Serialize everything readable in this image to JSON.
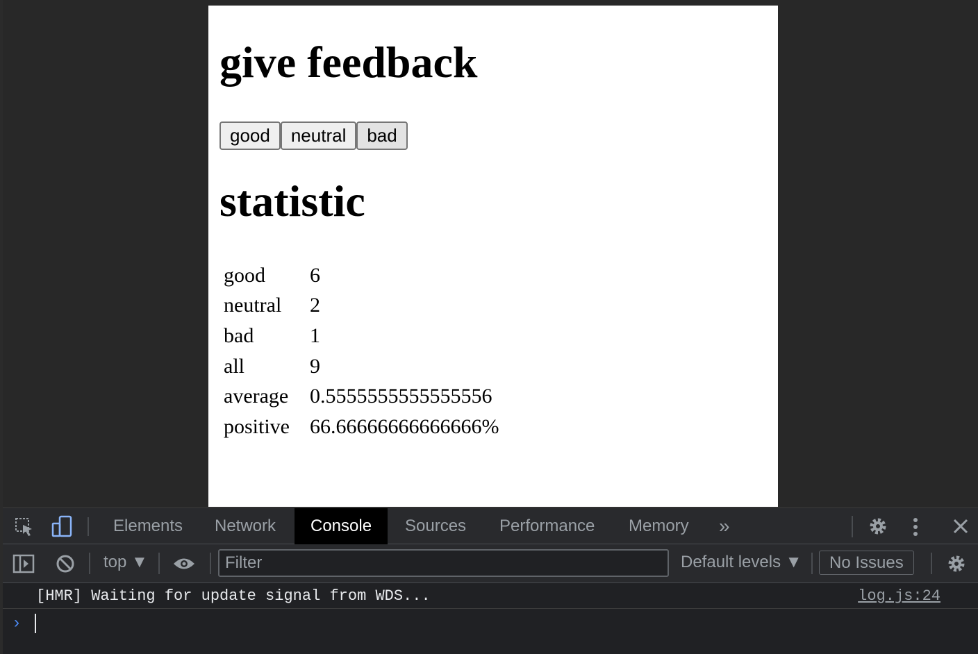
{
  "page": {
    "feedback_heading": "give feedback",
    "buttons": [
      "good",
      "neutral",
      "bad"
    ],
    "statistic_heading": "statistic",
    "stats": [
      {
        "label": "good",
        "value": "6"
      },
      {
        "label": "neutral",
        "value": "2"
      },
      {
        "label": "bad",
        "value": "1"
      },
      {
        "label": "all",
        "value": "9"
      },
      {
        "label": "average",
        "value": "0.5555555555555556"
      },
      {
        "label": "positive",
        "value": "66.66666666666666%"
      }
    ]
  },
  "devtools": {
    "tabs": [
      "Elements",
      "Network",
      "Console",
      "Sources",
      "Performance",
      "Memory"
    ],
    "active_tab": "Console",
    "more_tabs": "»",
    "context": "top ▼",
    "filter_placeholder": "Filter",
    "levels": "Default levels ▼",
    "issues": "No Issues",
    "console_message": "[HMR] Waiting for update signal from WDS...",
    "console_source": "log.js:24",
    "prompt": "›"
  },
  "colors": {
    "devtools_bg": "#202124",
    "active_tab_bg": "#000000",
    "prompt": "#4d8bf5"
  }
}
